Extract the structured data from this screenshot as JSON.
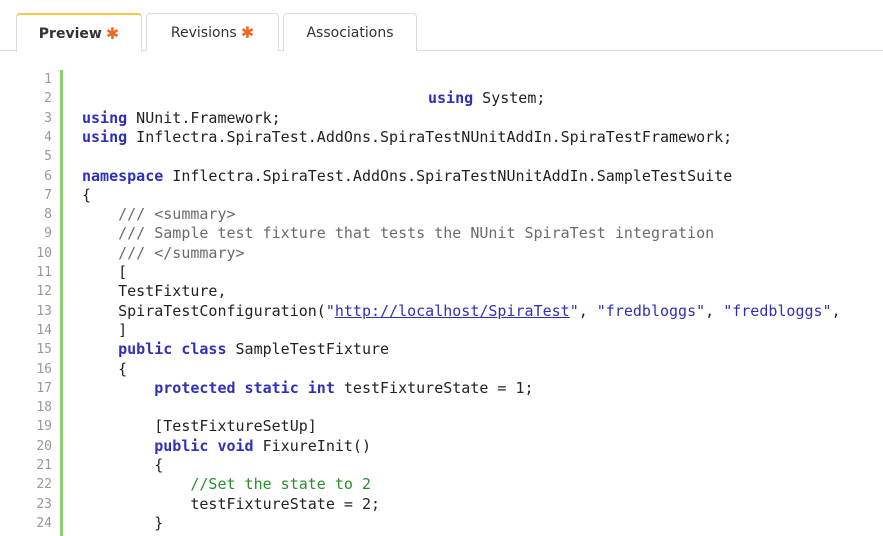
{
  "tabs": [
    {
      "id": "preview",
      "label": "Preview",
      "modified": true,
      "active": true
    },
    {
      "id": "revisions",
      "label": "Revisions",
      "modified": true,
      "active": false
    },
    {
      "id": "associations",
      "label": "Associations",
      "modified": false,
      "active": false
    }
  ],
  "colors": {
    "accent_star": "#f26522",
    "active_tab_border": "#f2c94c",
    "gutter_bar": "#8bd26e",
    "keyword": "#2f2fb8",
    "comment": "#6b6b6b",
    "comment_green": "#2a8f2a"
  },
  "code": {
    "lines": [
      {
        "n": "1",
        "parts": []
      },
      {
        "n": "2",
        "parts": [
          {
            "t": "kw",
            "v": "using"
          },
          {
            "t": "tx",
            "v": " System;"
          }
        ],
        "pad": 346
      },
      {
        "n": "3",
        "parts": [
          {
            "t": "kw",
            "v": "using"
          },
          {
            "t": "tx",
            "v": " NUnit.Framework;"
          }
        ]
      },
      {
        "n": "4",
        "parts": [
          {
            "t": "kw",
            "v": "using"
          },
          {
            "t": "tx",
            "v": " Inflectra.SpiraTest.AddOns.SpiraTestNUnitAddIn.SpiraTestFramework;"
          }
        ]
      },
      {
        "n": "5",
        "parts": []
      },
      {
        "n": "6",
        "parts": [
          {
            "t": "kw",
            "v": "namespace"
          },
          {
            "t": "tx",
            "v": " Inflectra.SpiraTest.AddOns.SpiraTestNUnitAddIn.SampleTestSuite"
          }
        ]
      },
      {
        "n": "7",
        "parts": [
          {
            "t": "tx",
            "v": "{"
          }
        ]
      },
      {
        "n": "8",
        "parts": [
          {
            "t": "cm",
            "v": "    /// <summary>"
          }
        ]
      },
      {
        "n": "9",
        "parts": [
          {
            "t": "cm",
            "v": "    /// Sample test fixture that tests the NUnit SpiraTest integration"
          }
        ]
      },
      {
        "n": "10",
        "parts": [
          {
            "t": "cm",
            "v": "    /// </summary>"
          }
        ]
      },
      {
        "n": "11",
        "parts": [
          {
            "t": "tx",
            "v": "    ["
          }
        ]
      },
      {
        "n": "12",
        "parts": [
          {
            "t": "tx",
            "v": "    TestFixture,"
          }
        ]
      },
      {
        "n": "13",
        "parts": [
          {
            "t": "tx",
            "v": "    SpiraTestConfiguration("
          },
          {
            "t": "st",
            "v": "\""
          },
          {
            "t": "lk",
            "v": "http://localhost/SpiraTest"
          },
          {
            "t": "st",
            "v": "\""
          },
          {
            "t": "tx",
            "v": ", "
          },
          {
            "t": "st",
            "v": "\"fredbloggs\""
          },
          {
            "t": "tx",
            "v": ", "
          },
          {
            "t": "st",
            "v": "\"fredbloggs\""
          },
          {
            "t": "tx",
            "v": ","
          }
        ]
      },
      {
        "n": "14",
        "parts": [
          {
            "t": "tx",
            "v": "    ]"
          }
        ]
      },
      {
        "n": "15",
        "parts": [
          {
            "t": "kw",
            "v": "    public class"
          },
          {
            "t": "tx",
            "v": " SampleTestFixture"
          }
        ]
      },
      {
        "n": "16",
        "parts": [
          {
            "t": "tx",
            "v": "    {"
          }
        ]
      },
      {
        "n": "17",
        "parts": [
          {
            "t": "kw",
            "v": "        protected static int"
          },
          {
            "t": "tx",
            "v": " testFixtureState = 1;"
          }
        ]
      },
      {
        "n": "18",
        "parts": []
      },
      {
        "n": "19",
        "parts": [
          {
            "t": "tx",
            "v": "        [TestFixtureSetUp]"
          }
        ]
      },
      {
        "n": "20",
        "parts": [
          {
            "t": "kw",
            "v": "        public void"
          },
          {
            "t": "tx",
            "v": " FixureInit()"
          }
        ]
      },
      {
        "n": "21",
        "parts": [
          {
            "t": "tx",
            "v": "        {"
          }
        ]
      },
      {
        "n": "22",
        "parts": [
          {
            "t": "cg",
            "v": "            //Set the state to 2"
          }
        ]
      },
      {
        "n": "23",
        "parts": [
          {
            "t": "tx",
            "v": "            testFixtureState = 2;"
          }
        ]
      },
      {
        "n": "24",
        "parts": [
          {
            "t": "tx",
            "v": "        }"
          }
        ]
      }
    ]
  }
}
